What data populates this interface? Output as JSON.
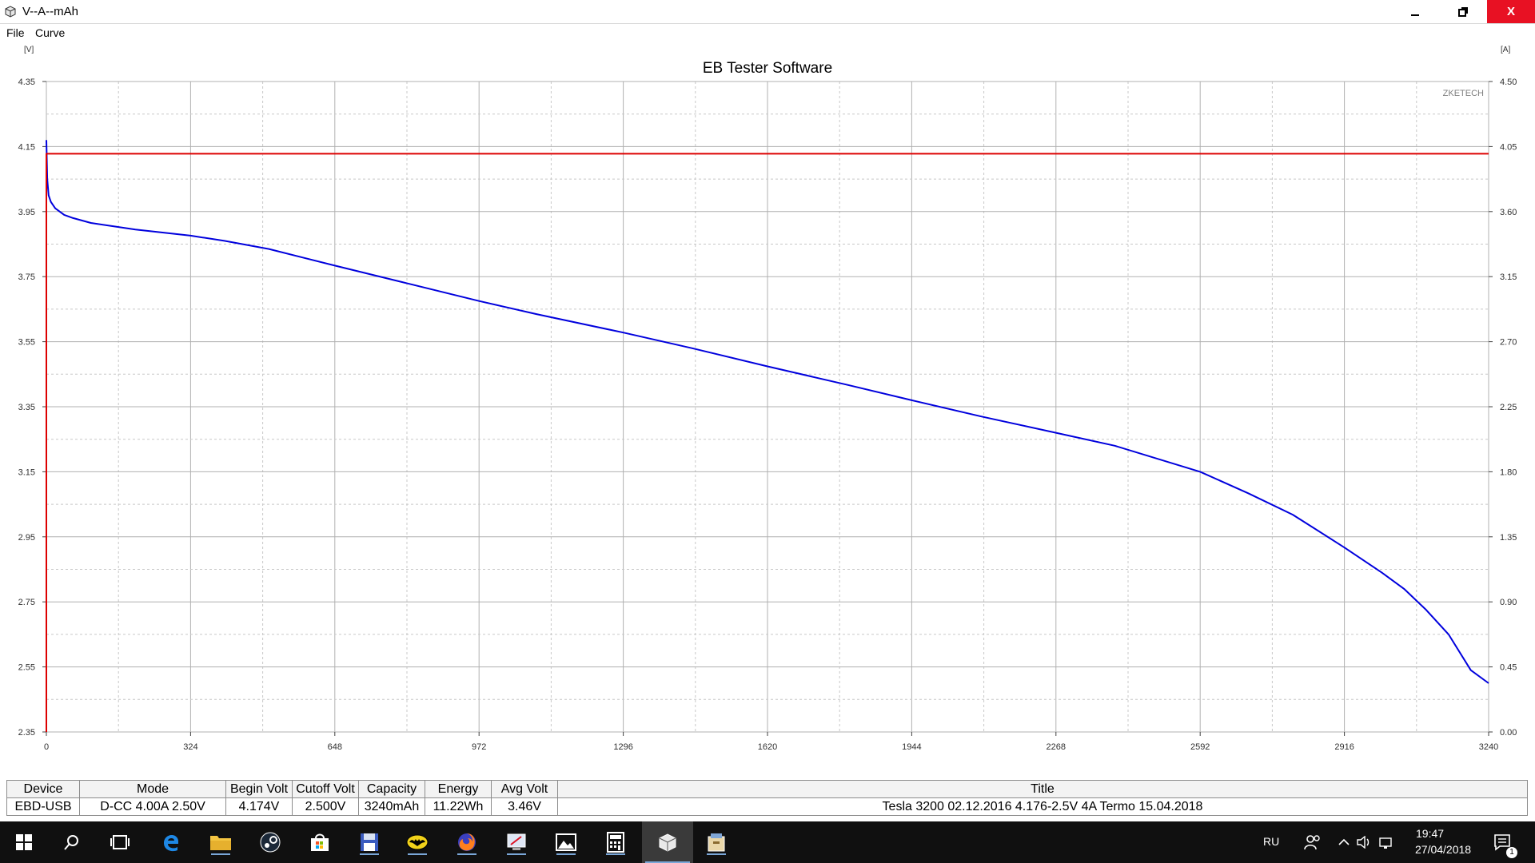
{
  "window": {
    "title": "V--A--mAh",
    "minimize_icon": "minimize-icon",
    "maximize_icon": "restore-icon",
    "close_icon": "close-icon",
    "close_label": "X"
  },
  "menu": {
    "items": [
      "File",
      "Curve"
    ]
  },
  "chart_data": {
    "type": "line",
    "title": "EB Tester Software",
    "watermark": "ZKETECH",
    "left_unit": "[V]",
    "right_unit": "[A]",
    "x_ticks": [
      "0",
      "324",
      "648",
      "972",
      "1296",
      "1620",
      "1944",
      "2268",
      "2592",
      "2916",
      "3240"
    ],
    "y_left_ticks": [
      "4.35",
      "4.15",
      "3.95",
      "3.75",
      "3.55",
      "3.35",
      "3.15",
      "2.95",
      "2.75",
      "2.55",
      "2.35"
    ],
    "y_right_ticks": [
      "4.50",
      "4.05",
      "3.60",
      "3.15",
      "2.70",
      "2.25",
      "1.80",
      "1.35",
      "0.90",
      "0.45",
      "0.00"
    ],
    "xlim": [
      0,
      3240
    ],
    "ylim_left": [
      2.35,
      4.35
    ],
    "ylim_right": [
      0,
      4.5
    ],
    "grid": true,
    "series": [
      {
        "axis": "left",
        "color": "#0000dd",
        "x": [
          0,
          2,
          5,
          10,
          20,
          40,
          60,
          100,
          150,
          200,
          324,
          400,
          500,
          648,
          800,
          972,
          1100,
          1296,
          1450,
          1620,
          1800,
          1944,
          2100,
          2268,
          2400,
          2592,
          2700,
          2800,
          2916,
          3000,
          3050,
          3100,
          3150,
          3200,
          3240
        ],
        "y": [
          4.17,
          4.05,
          4.0,
          3.98,
          3.96,
          3.94,
          3.93,
          3.915,
          3.905,
          3.895,
          3.876,
          3.86,
          3.835,
          3.784,
          3.733,
          3.675,
          3.635,
          3.578,
          3.53,
          3.474,
          3.417,
          3.37,
          3.32,
          3.27,
          3.23,
          3.15,
          3.084,
          3.018,
          2.917,
          2.84,
          2.79,
          2.725,
          2.65,
          2.54,
          2.5
        ]
      },
      {
        "axis": "right",
        "color": "#dd0000",
        "x": [
          0,
          0,
          3,
          3240
        ],
        "y": [
          0,
          4.0,
          4.0,
          4.0
        ]
      }
    ]
  },
  "results": {
    "headers": [
      "Device",
      "Mode",
      "Begin Volt",
      "Cutoff Volt",
      "Capacity",
      "Energy",
      "Avg Volt",
      "Title"
    ],
    "row": [
      "EBD-USB",
      "D-CC  4.00A  2.50V",
      "4.174V",
      "2.500V",
      "3240mAh",
      "11.22Wh",
      "3.46V",
      "Tesla 3200 02.12.2016 4.176-2.5V 4A Termo 15.04.2018"
    ]
  },
  "taskbar": {
    "icons": [
      "start-icon",
      "search-icon",
      "task-view-icon",
      "edge-icon",
      "file-explorer-icon",
      "steam-icon",
      "store-icon",
      "save-disk-icon",
      "batman-icon",
      "firefox-icon",
      "remote-icon",
      "photos-icon",
      "calculator-icon",
      "eb-tester-icon",
      "archive-icon"
    ],
    "language": "RU",
    "time": "19:47",
    "date": "27/04/2018",
    "notification_count": "1"
  }
}
